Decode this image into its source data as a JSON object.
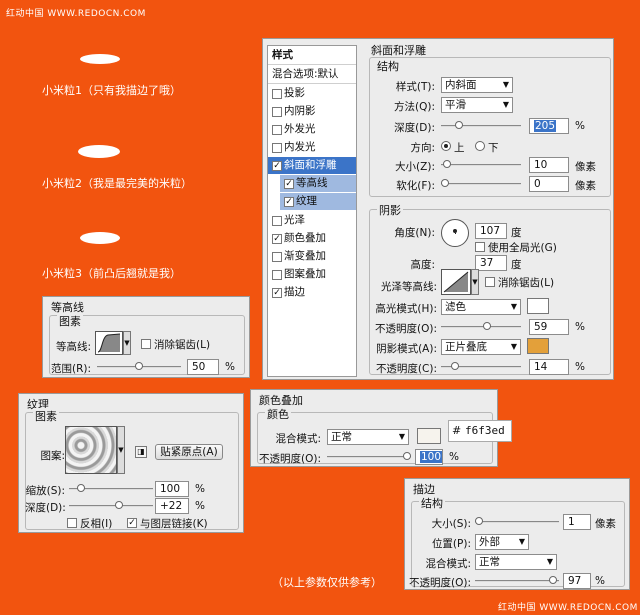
{
  "watermark_top": "红动中国 WWW.REDOCN.COM",
  "watermark_bottom": "红动中国 WWW.REDOCN.COM",
  "grains": [
    {
      "caption": "小米粒1（只有我描边了哦）"
    },
    {
      "caption": "小米粒2（我是最完美的米粒）"
    },
    {
      "caption": "小米粒3（前凸后翘就是我）"
    }
  ],
  "footnote": "（以上参数仅供参考）",
  "colors": {
    "background": "#f2540f",
    "highlight": "#3b74c8",
    "shadow_color": "#e3a03a",
    "overlay_color": "#f6f3ed",
    "highlight_color": "#ffffff"
  },
  "layer_style": {
    "title": "样式",
    "items": [
      {
        "label": "混合选项:默认",
        "checkbox": false
      },
      {
        "label": "投影",
        "checkbox": true,
        "checked": false
      },
      {
        "label": "内阴影",
        "checkbox": true,
        "checked": false
      },
      {
        "label": "外发光",
        "checkbox": true,
        "checked": false
      },
      {
        "label": "内发光",
        "checkbox": true,
        "checked": false
      },
      {
        "label": "斜面和浮雕",
        "checkbox": true,
        "checked": true,
        "selected": true
      },
      {
        "label": "等高线",
        "checkbox": true,
        "checked": true,
        "sub": true
      },
      {
        "label": "纹理",
        "checkbox": true,
        "checked": true,
        "sub": true
      },
      {
        "label": "光泽",
        "checkbox": true,
        "checked": false
      },
      {
        "label": "颜色叠加",
        "checkbox": true,
        "checked": true
      },
      {
        "label": "渐变叠加",
        "checkbox": true,
        "checked": false
      },
      {
        "label": "图案叠加",
        "checkbox": true,
        "checked": false
      },
      {
        "label": "描边",
        "checkbox": true,
        "checked": true
      }
    ]
  },
  "bevel": {
    "title": "斜面和浮雕",
    "structure_title": "结构",
    "style_label": "样式(T):",
    "style_value": "内斜面",
    "technique_label": "方法(Q):",
    "technique_value": "平滑",
    "depth_label": "深度(D):",
    "depth_value": "205",
    "depth_unit": "%",
    "depth_level": 0.2,
    "direction_label": "方向:",
    "dir_up": "上",
    "dir_down": "下",
    "size_label": "大小(Z):",
    "size_value": "10",
    "size_unit": "像素",
    "size_level": 0.03,
    "soften_label": "软化(F):",
    "soften_value": "0",
    "soften_unit": "像素",
    "soften_level": 0.0,
    "shading_title": "阴影",
    "angle_label": "角度(N):",
    "angle_value": "107",
    "angle_unit": "度",
    "global_light_label": "使用全局光(G)",
    "altitude_label": "高度:",
    "altitude_value": "37",
    "altitude_unit": "度",
    "gloss_label": "光泽等高线:",
    "antialias_label": "消除锯齿(L)",
    "hl_mode_label": "高光模式(H):",
    "hl_mode_value": "滤色",
    "hl_opacity_label": "不透明度(O):",
    "hl_opacity_value": "59",
    "hl_opacity_unit": "%",
    "hl_opacity_level": 0.59,
    "sh_mode_label": "阴影模式(A):",
    "sh_mode_value": "正片叠底",
    "sh_opacity_label": "不透明度(C):",
    "sh_opacity_value": "14",
    "sh_opacity_unit": "%",
    "sh_opacity_level": 0.14
  },
  "contour": {
    "title": "等高线",
    "group_title": "图素",
    "contour_label": "等高线:",
    "antialias_label": "消除锯齿(L)",
    "range_label": "范围(R):",
    "range_value": "50",
    "range_unit": "%",
    "range_level": 0.5
  },
  "texture": {
    "title": "纹理",
    "group_title": "图素",
    "pattern_label": "图案:",
    "snap_button": "贴紧原点(A)",
    "scale_label": "缩放(S):",
    "scale_value": "100",
    "scale_unit": "%",
    "scale_level": 0.1,
    "depth_label": "深度(D):",
    "depth_value": "+22",
    "depth_unit": "%",
    "depth_level": 0.61,
    "invert_label": "反相(I)",
    "link_label": "与图层链接(K)"
  },
  "color_overlay": {
    "title": "颜色叠加",
    "group_title": "颜色",
    "mode_label": "混合模式:",
    "mode_value": "正常",
    "hex_prefix": "#",
    "hex_value": "f6f3ed",
    "opacity_label": "不透明度(O):",
    "opacity_value": "100",
    "opacity_unit": "%",
    "opacity_level": 1.0
  },
  "stroke": {
    "title": "描边",
    "group_title": "结构",
    "size_label": "大小(S):",
    "size_value": "1",
    "size_unit": "像素",
    "size_level": 0.0,
    "position_label": "位置(P):",
    "position_value": "外部",
    "mode_label": "混合模式:",
    "mode_value": "正常",
    "opacity_label": "不透明度(O):",
    "opacity_value": "97",
    "opacity_unit": "%",
    "opacity_level": 0.97
  }
}
